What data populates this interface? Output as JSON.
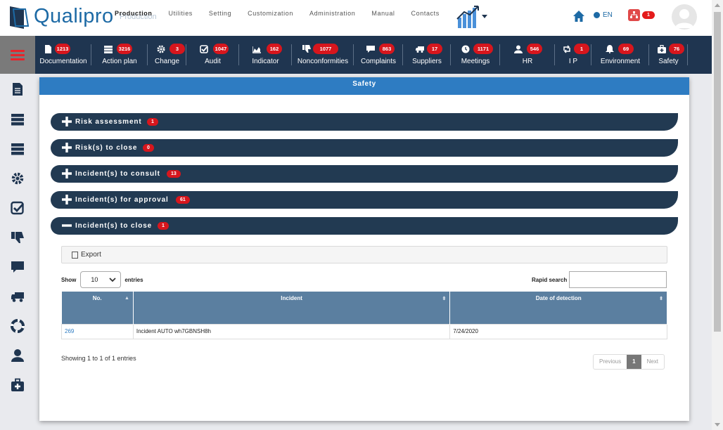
{
  "header": {
    "logo_text": "Qualipro",
    "logo_subtitle": "Production",
    "nav": [
      "Production",
      "Utilities",
      "Setting",
      "Customization",
      "Administration",
      "Manual",
      "Contacts"
    ],
    "language": "EN",
    "notification_count": "1",
    "accent_color": "#1d6aa5"
  },
  "modules": [
    {
      "label": "Documentation",
      "count": "1213",
      "icon": "document-icon"
    },
    {
      "label": "Action plan",
      "count": "3216",
      "icon": "server-icon"
    },
    {
      "label": "Change",
      "count": "3",
      "icon": "gear-icon"
    },
    {
      "label": "Audit",
      "count": "1047",
      "icon": "checkbox-icon"
    },
    {
      "label": "Indicator",
      "count": "162",
      "icon": "area-chart-icon"
    },
    {
      "label": "Nonconformities",
      "count": "1077",
      "icon": "thumbs-down-icon"
    },
    {
      "label": "Complaints",
      "count": "863",
      "icon": "comment-icon"
    },
    {
      "label": "Suppliers",
      "count": "17",
      "icon": "truck-icon"
    },
    {
      "label": "Meetings",
      "count": "1171",
      "icon": "clock-icon"
    },
    {
      "label": "HR",
      "count": "546",
      "icon": "user-icon"
    },
    {
      "label": "I P",
      "count": "1",
      "icon": "retweet-icon"
    },
    {
      "label": "Environment",
      "count": "69",
      "icon": "bell-icon"
    },
    {
      "label": "Safety",
      "count": "76",
      "icon": "medkit-icon"
    }
  ],
  "panel": {
    "title": "Safety",
    "sections": [
      {
        "title": "Risk assessment",
        "count": "1",
        "expanded": false
      },
      {
        "title": "Risk(s) to close",
        "count": "0",
        "expanded": false
      },
      {
        "title": "Incident(s) to consult",
        "count": "13",
        "expanded": false
      },
      {
        "title": "Incident(s) for approval",
        "count": "61",
        "expanded": false
      },
      {
        "title": "Incident(s) to close",
        "count": "1",
        "expanded": true
      }
    ]
  },
  "table": {
    "export_label": "Export",
    "show_label": "Show",
    "entries_label": "entries",
    "page_size": "10",
    "search_label": "Rapid search",
    "columns": [
      "No.",
      "Incident",
      "Date of detection"
    ],
    "rows": [
      {
        "no": "269",
        "incident": "Incident AUTO wh7GBNSH8h",
        "date": "7/24/2020"
      }
    ],
    "info": "Showing 1 to 1 of 1 entries",
    "pagination": {
      "previous": "Previous",
      "current": "1",
      "next": "Next"
    }
  }
}
